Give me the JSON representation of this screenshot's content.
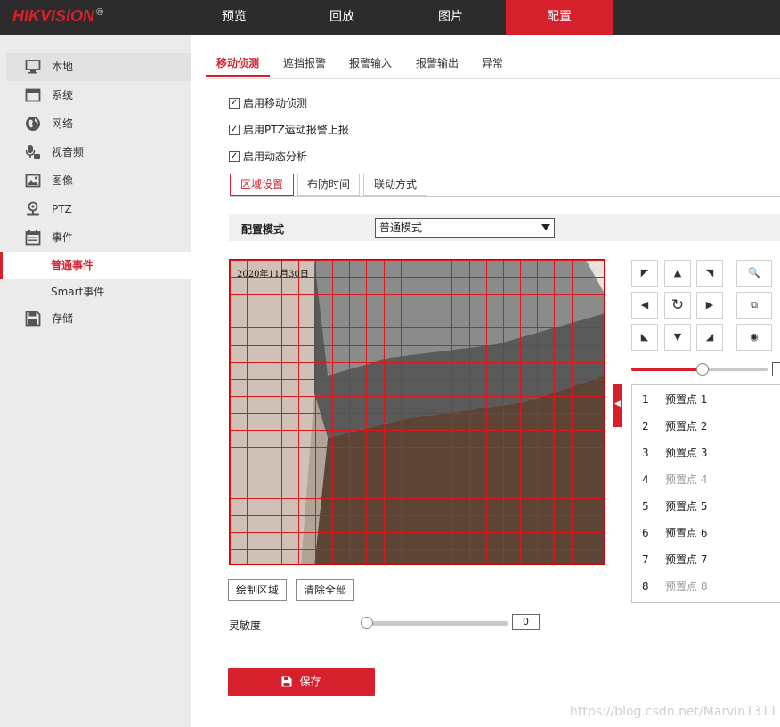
{
  "brand": {
    "name": "HIKVISION",
    "reg": "®",
    "accent": "#d6202c",
    "topbar_bg": "#2c2c2c"
  },
  "topnav": [
    {
      "label": "预览",
      "active": false
    },
    {
      "label": "回放",
      "active": false
    },
    {
      "label": "图片",
      "active": false
    },
    {
      "label": "配置",
      "active": true
    }
  ],
  "sidebar": {
    "items": [
      {
        "label": "本地",
        "icon": "monitor-icon"
      },
      {
        "label": "系统",
        "icon": "system-window-icon"
      },
      {
        "label": "网络",
        "icon": "globe-icon"
      },
      {
        "label": "视音频",
        "icon": "mic-camera-icon"
      },
      {
        "label": "图像",
        "icon": "image-icon"
      },
      {
        "label": "PTZ",
        "icon": "ptz-icon"
      },
      {
        "label": "事件",
        "icon": "calendar-icon"
      }
    ],
    "sub": [
      {
        "label": "普通事件",
        "active": true
      },
      {
        "label": "Smart事件",
        "active": false
      }
    ],
    "storage": {
      "label": "存储",
      "icon": "floppy-icon"
    }
  },
  "tabs": [
    {
      "label": "移动侦测",
      "active": true
    },
    {
      "label": "遮挡报警",
      "active": false
    },
    {
      "label": "报警输入",
      "active": false
    },
    {
      "label": "报警输出",
      "active": false
    },
    {
      "label": "异常",
      "active": false
    }
  ],
  "checkboxes": [
    {
      "label": "启用移动侦测",
      "checked": true
    },
    {
      "label": "启用PTZ运动报警上报",
      "checked": true
    },
    {
      "label": "启用动态分析",
      "checked": true
    }
  ],
  "subtabs": [
    {
      "label": "区域设置",
      "active": true
    },
    {
      "label": "布防时间",
      "active": false
    },
    {
      "label": "联动方式",
      "active": false
    }
  ],
  "config_mode": {
    "label": "配置模式",
    "value": "普通模式"
  },
  "video": {
    "osd_text": "2020年11月30日"
  },
  "ptz": {
    "speed": 0.52
  },
  "presets": [
    {
      "num": "1",
      "name": "预置点 1",
      "dim": false
    },
    {
      "num": "2",
      "name": "预置点 2",
      "dim": false
    },
    {
      "num": "3",
      "name": "预置点 3",
      "dim": false
    },
    {
      "num": "4",
      "name": "预置点 4",
      "dim": true
    },
    {
      "num": "5",
      "name": "预置点 5",
      "dim": false
    },
    {
      "num": "6",
      "name": "预置点 6",
      "dim": false
    },
    {
      "num": "7",
      "name": "预置点 7",
      "dim": false
    },
    {
      "num": "8",
      "name": "预置点 8",
      "dim": true
    }
  ],
  "buttons": {
    "draw_area": "绘制区域",
    "clear_all": "清除全部",
    "save": "保存"
  },
  "sensitivity": {
    "label": "灵敏度",
    "value": "0"
  },
  "watermark": "https://blog.csdn.net/Marvin1311"
}
